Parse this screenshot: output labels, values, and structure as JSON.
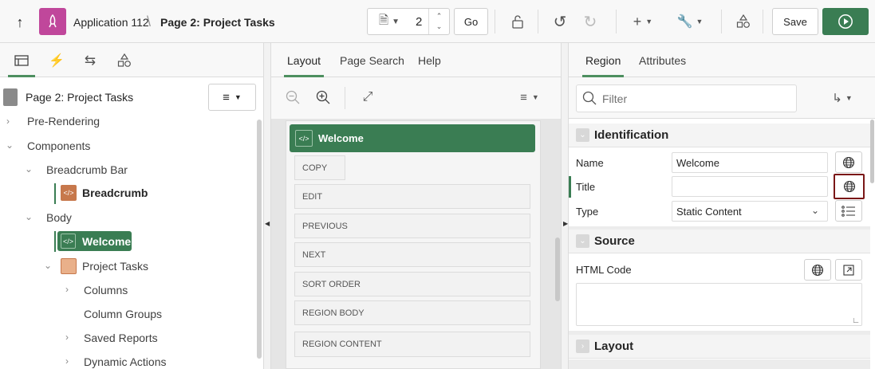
{
  "toolbar": {
    "app_name": "Application 112",
    "page_title": "Page 2: Project Tasks",
    "page_number": "2",
    "go_label": "Go",
    "save_label": "Save"
  },
  "left": {
    "page_node": "Page 2: Project Tasks",
    "tree": {
      "pre_rendering": "Pre-Rendering",
      "components": "Components",
      "breadcrumb_bar": "Breadcrumb Bar",
      "breadcrumb": "Breadcrumb",
      "body": "Body",
      "welcome": "Welcome",
      "project_tasks": "Project Tasks",
      "columns": "Columns",
      "column_groups": "Column Groups",
      "saved_reports": "Saved Reports",
      "dynamic_actions": "Dynamic Actions"
    }
  },
  "middle": {
    "tabs": [
      "Layout",
      "Page Search",
      "Help"
    ],
    "region_title": "Welcome",
    "positions": [
      "COPY",
      "EDIT",
      "PREVIOUS",
      "NEXT",
      "SORT ORDER",
      "REGION BODY",
      "REGION CONTENT"
    ]
  },
  "right": {
    "tabs": [
      "Region",
      "Attributes"
    ],
    "filter_placeholder": "Filter",
    "identification": {
      "heading": "Identification",
      "name_label": "Name",
      "name_value": "Welcome",
      "title_label": "Title",
      "title_value": "",
      "type_label": "Type",
      "type_value": "Static Content"
    },
    "source": {
      "heading": "Source",
      "html_code_label": "HTML Code"
    },
    "layout_heading": "Layout"
  },
  "colors": {
    "accent_green": "#3a7d53",
    "app_icon_bg": "#c0479b",
    "highlight_border": "#7a1717"
  }
}
